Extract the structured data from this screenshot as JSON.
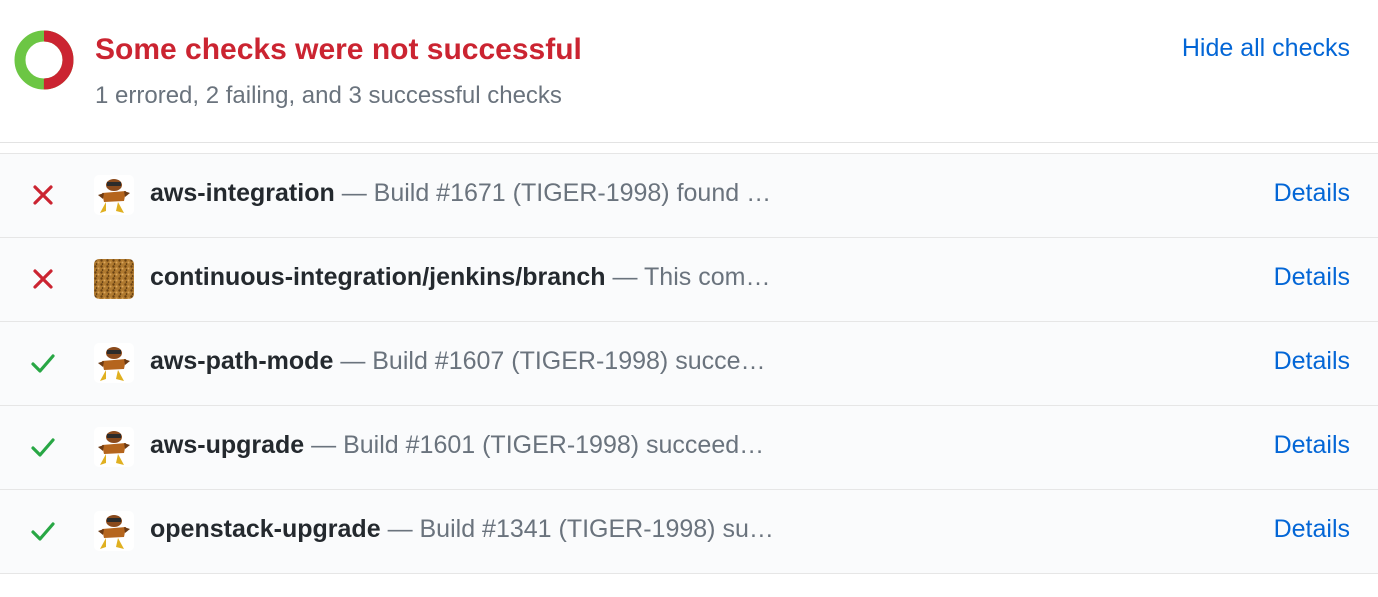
{
  "header": {
    "title": "Some checks were not successful",
    "subtitle": "1 errored, 2 failing, and 3 successful checks",
    "hide_link": "Hide all checks",
    "status_colors": {
      "success": "#6cc644",
      "failure": "#cb2431",
      "error": "#cb2431"
    }
  },
  "checks": [
    {
      "status": "failure",
      "icon": "close-icon",
      "avatar": "robot-avatar",
      "name": "aws-integration",
      "description": "— Build #1671 (TIGER-1998) found …",
      "details": "Details"
    },
    {
      "status": "failure",
      "icon": "close-icon",
      "avatar": "jenkins-avatar",
      "name": "continuous-integration/jenkins/branch",
      "description": "— This com…",
      "details": "Details"
    },
    {
      "status": "success",
      "icon": "check-icon",
      "avatar": "robot-avatar",
      "name": "aws-path-mode",
      "description": "— Build #1607 (TIGER-1998) succe…",
      "details": "Details"
    },
    {
      "status": "success",
      "icon": "check-icon",
      "avatar": "robot-avatar",
      "name": "aws-upgrade",
      "description": "— Build #1601 (TIGER-1998) succeed…",
      "details": "Details"
    },
    {
      "status": "success",
      "icon": "check-icon",
      "avatar": "robot-avatar",
      "name": "openstack-upgrade",
      "description": "— Build #1341 (TIGER-1998) su…",
      "details": "Details"
    }
  ]
}
